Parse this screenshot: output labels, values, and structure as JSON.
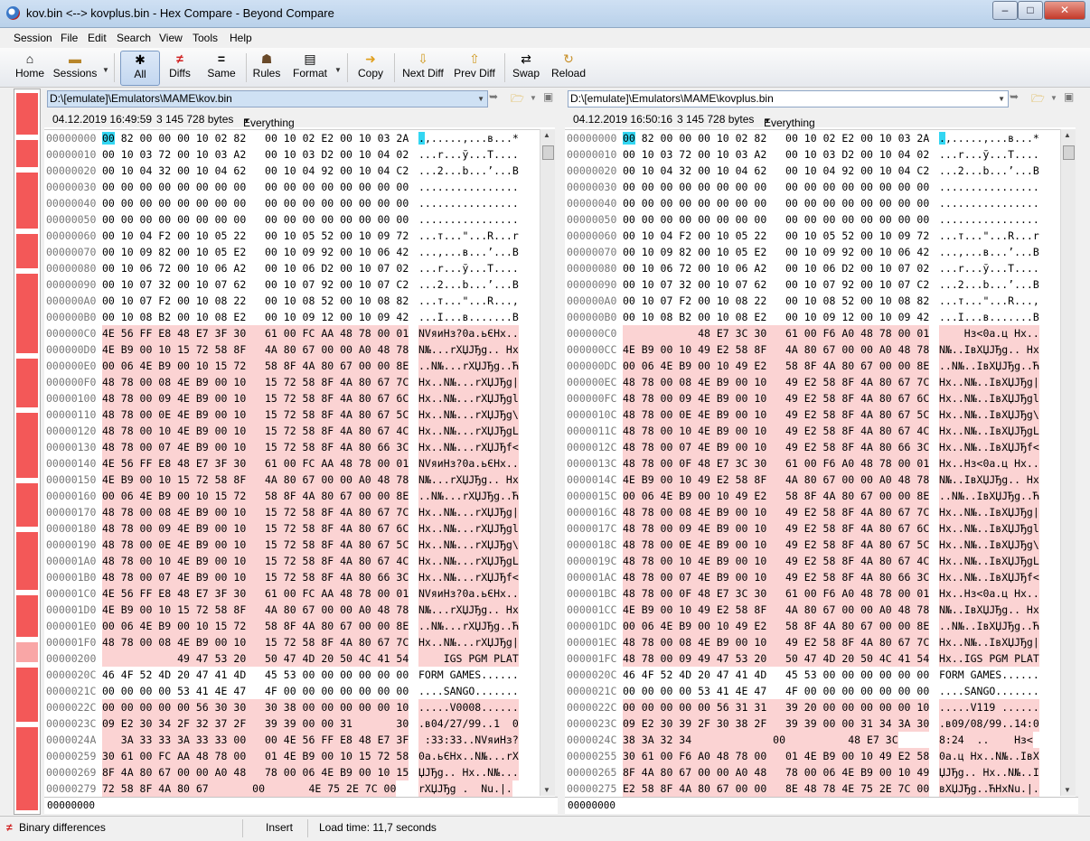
{
  "window": {
    "title": "kov.bin <--> kovplus.bin - Hex Compare - Beyond Compare"
  },
  "menu": [
    "Session",
    "File",
    "Edit",
    "Search",
    "View",
    "Tools",
    "Help"
  ],
  "toolbar": {
    "home": "Home",
    "sessions": "Sessions",
    "all": "All",
    "diffs": "Diffs",
    "same": "Same",
    "rules": "Rules",
    "format": "Format",
    "copy": "Copy",
    "next_diff": "Next Diff",
    "prev_diff": "Prev Diff",
    "swap": "Swap",
    "reload": "Reload"
  },
  "left": {
    "path": "D:\\[emulate]\\Emulators\\MAME\\kov.bin",
    "date": "04.12.2019 16:49:59",
    "size": "3 145 728 bytes",
    "format": "Everything Else",
    "offset": "00000000",
    "rows": [
      {
        "a": "00000000",
        "h": "00 82 00 00 00 10 02 82   00 10 02 E2 00 10 03 2A",
        "t": ".,.....,...в...*",
        "d": 0
      },
      {
        "a": "00000010",
        "h": "00 10 03 72 00 10 03 A2   00 10 03 D2 00 10 04 02",
        "t": "...r...ў...T....",
        "d": 0
      },
      {
        "a": "00000020",
        "h": "00 10 04 32 00 10 04 62   00 10 04 92 00 10 04 C2",
        "t": "...2...b...’...В",
        "d": 0
      },
      {
        "a": "00000030",
        "h": "00 00 00 00 00 00 00 00   00 00 00 00 00 00 00 00",
        "t": "................",
        "d": 0
      },
      {
        "a": "00000040",
        "h": "00 00 00 00 00 00 00 00   00 00 00 00 00 00 00 00",
        "t": "................",
        "d": 0
      },
      {
        "a": "00000050",
        "h": "00 00 00 00 00 00 00 00   00 00 00 00 00 00 00 00",
        "t": "................",
        "d": 0
      },
      {
        "a": "00000060",
        "h": "00 10 04 F2 00 10 05 22   00 10 05 52 00 10 09 72",
        "t": "...т...\"...R...r",
        "d": 0
      },
      {
        "a": "00000070",
        "h": "00 10 09 82 00 10 05 E2   00 10 09 92 00 10 06 42",
        "t": "...,...в...’...B",
        "d": 0
      },
      {
        "a": "00000080",
        "h": "00 10 06 72 00 10 06 A2   00 10 06 D2 00 10 07 02",
        "t": "...r...ў...T....",
        "d": 0
      },
      {
        "a": "00000090",
        "h": "00 10 07 32 00 10 07 62   00 10 07 92 00 10 07 C2",
        "t": "...2...b...’...В",
        "d": 0
      },
      {
        "a": "000000A0",
        "h": "00 10 07 F2 00 10 08 22   00 10 08 52 00 10 08 82",
        "t": "...т...\"...R...,",
        "d": 0
      },
      {
        "a": "000000B0",
        "h": "00 10 08 B2 00 10 08 E2   00 10 09 12 00 10 09 42",
        "t": "...I...в.......B",
        "d": 0
      },
      {
        "a": "000000C0",
        "h": "4E 56 FF E8 48 E7 3F 30   61 00 FC AA 48 78 00 01",
        "t": "NVяиНз?0a.ьЄHx..",
        "d": 1
      },
      {
        "a": "000000D0",
        "h": "4E B9 00 10 15 72 58 8F   4A 80 67 00 00 A0 48 78",
        "t": "N№...rXЏJЂg.. Hx",
        "d": 1
      },
      {
        "a": "000000E0",
        "h": "00 06 4E B9 00 10 15 72   58 8F 4A 80 67 00 00 8E",
        "t": "..N№...rXЏJЂg..Ћ",
        "d": 1
      },
      {
        "a": "000000F0",
        "h": "48 78 00 08 4E B9 00 10   15 72 58 8F 4A 80 67 7C",
        "t": "Hx..N№...rXЏJЂg|",
        "d": 1
      },
      {
        "a": "00000100",
        "h": "48 78 00 09 4E B9 00 10   15 72 58 8F 4A 80 67 6C",
        "t": "Hx..N№...rXЏJЂgl",
        "d": 1
      },
      {
        "a": "00000110",
        "h": "48 78 00 0E 4E B9 00 10   15 72 58 8F 4A 80 67 5C",
        "t": "Hx..N№...rXЏJЂg\\",
        "d": 1
      },
      {
        "a": "00000120",
        "h": "48 78 00 10 4E B9 00 10   15 72 58 8F 4A 80 67 4C",
        "t": "Hx..N№...rXЏJЂgL",
        "d": 1
      },
      {
        "a": "00000130",
        "h": "48 78 00 07 4E B9 00 10   15 72 58 8F 4A 80 66 3C",
        "t": "Hx..N№...rXЏJЂf<",
        "d": 1
      },
      {
        "a": "00000140",
        "h": "4E 56 FF E8 48 E7 3F 30   61 00 FC AA 48 78 00 01",
        "t": "NVяиНз?0a.ьЄHx..",
        "d": 1
      },
      {
        "a": "00000150",
        "h": "4E B9 00 10 15 72 58 8F   4A 80 67 00 00 A0 48 78",
        "t": "N№...rXЏJЂg.. Hx",
        "d": 1
      },
      {
        "a": "00000160",
        "h": "00 06 4E B9 00 10 15 72   58 8F 4A 80 67 00 00 8E",
        "t": "..N№...rXЏJЂg..Ћ",
        "d": 1
      },
      {
        "a": "00000170",
        "h": "48 78 00 08 4E B9 00 10   15 72 58 8F 4A 80 67 7C",
        "t": "Hx..N№...rXЏJЂg|",
        "d": 1
      },
      {
        "a": "00000180",
        "h": "48 78 00 09 4E B9 00 10   15 72 58 8F 4A 80 67 6C",
        "t": "Hx..N№...rXЏJЂgl",
        "d": 1
      },
      {
        "a": "00000190",
        "h": "48 78 00 0E 4E B9 00 10   15 72 58 8F 4A 80 67 5C",
        "t": "Hx..N№...rXЏJЂg\\",
        "d": 1
      },
      {
        "a": "000001A0",
        "h": "48 78 00 10 4E B9 00 10   15 72 58 8F 4A 80 67 4C",
        "t": "Hx..N№...rXЏJЂgL",
        "d": 1
      },
      {
        "a": "000001B0",
        "h": "48 78 00 07 4E B9 00 10   15 72 58 8F 4A 80 66 3C",
        "t": "Hx..N№...rXЏJЂf<",
        "d": 1
      },
      {
        "a": "000001C0",
        "h": "4E 56 FF E8 48 E7 3F 30   61 00 FC AA 48 78 00 01",
        "t": "NVяиНз?0a.ьЄHx..",
        "d": 1
      },
      {
        "a": "000001D0",
        "h": "4E B9 00 10 15 72 58 8F   4A 80 67 00 00 A0 48 78",
        "t": "N№...rXЏJЂg.. Hx",
        "d": 1
      },
      {
        "a": "000001E0",
        "h": "00 06 4E B9 00 10 15 72   58 8F 4A 80 67 00 00 8E",
        "t": "..N№...rXЏJЂg..Ћ",
        "d": 1
      },
      {
        "a": "000001F0",
        "h": "48 78 00 08 4E B9 00 10   15 72 58 8F 4A 80 67 7C",
        "t": "Hx..N№...rXЏJЂg|",
        "d": 1
      },
      {
        "a": "00000200",
        "h": "            49 47 53 20   50 47 4D 20 50 4C 41 54",
        "t": "    IGS PGM PLAT",
        "d": 1
      },
      {
        "a": "0000020C",
        "h": "46 4F 52 4D 20 47 41 4D   45 53 00 00 00 00 00 00",
        "t": "FORM GAMES......",
        "d": 0
      },
      {
        "a": "0000021C",
        "h": "00 00 00 00 53 41 4E 47   4F 00 00 00 00 00 00 00",
        "t": "....SANGO.......",
        "d": 0
      },
      {
        "a": "0000022C",
        "h": "00 00 00 00 00 56 30 30   30 38 00 00 00 00 00 10",
        "t": ".....V0008......",
        "d": 1
      },
      {
        "a": "0000023C",
        "h": "09 E2 30 34 2F 32 37 2F   39 39 00 00 31       30",
        "t": ".в04/27/99..1  0",
        "d": 1
      },
      {
        "a": "0000024A",
        "h": "   3A 33 33 3A 33 33 00   00 4E 56 FF E8 48 E7 3F",
        "t": " :33:33..NVяиНз?",
        "d": 1
      },
      {
        "a": "00000259",
        "h": "30 61 00 FC AA 48 78 00   01 4E B9 00 10 15 72 58",
        "t": "0a.ьЄHx..N№...rX",
        "d": 1
      },
      {
        "a": "00000269",
        "h": "8F 4A 80 67 00 00 A0 48   78 00 06 4E B9 00 10 15",
        "t": "ЏJЂg.. Hx..N№...",
        "d": 1
      },
      {
        "a": "00000279",
        "h": "72 58 8F 4A 80 67       00       4E 75 2E 7C 00",
        "t": "rXЏJЂg .  Nu.|.",
        "d": 1
      }
    ]
  },
  "right": {
    "path": "D:\\[emulate]\\Emulators\\MAME\\kovplus.bin",
    "date": "04.12.2019 16:50:16",
    "size": "3 145 728 bytes",
    "format": "Everything Else",
    "offset": "00000000",
    "rows": [
      {
        "a": "00000000",
        "h": "00 82 00 00 00 10 02 82   00 10 02 E2 00 10 03 2A",
        "t": ".,.....,...в...*",
        "d": 0
      },
      {
        "a": "00000010",
        "h": "00 10 03 72 00 10 03 A2   00 10 03 D2 00 10 04 02",
        "t": "...r...ў...T....",
        "d": 0
      },
      {
        "a": "00000020",
        "h": "00 10 04 32 00 10 04 62   00 10 04 92 00 10 04 C2",
        "t": "...2...b...’...В",
        "d": 0
      },
      {
        "a": "00000030",
        "h": "00 00 00 00 00 00 00 00   00 00 00 00 00 00 00 00",
        "t": "................",
        "d": 0
      },
      {
        "a": "00000040",
        "h": "00 00 00 00 00 00 00 00   00 00 00 00 00 00 00 00",
        "t": "................",
        "d": 0
      },
      {
        "a": "00000050",
        "h": "00 00 00 00 00 00 00 00   00 00 00 00 00 00 00 00",
        "t": "................",
        "d": 0
      },
      {
        "a": "00000060",
        "h": "00 10 04 F2 00 10 05 22   00 10 05 52 00 10 09 72",
        "t": "...т...\"...R...r",
        "d": 0
      },
      {
        "a": "00000070",
        "h": "00 10 09 82 00 10 05 E2   00 10 09 92 00 10 06 42",
        "t": "...,...в...’...B",
        "d": 0
      },
      {
        "a": "00000080",
        "h": "00 10 06 72 00 10 06 A2   00 10 06 D2 00 10 07 02",
        "t": "...r...ў...T....",
        "d": 0
      },
      {
        "a": "00000090",
        "h": "00 10 07 32 00 10 07 62   00 10 07 92 00 10 07 C2",
        "t": "...2...b...’...В",
        "d": 0
      },
      {
        "a": "000000A0",
        "h": "00 10 07 F2 00 10 08 22   00 10 08 52 00 10 08 82",
        "t": "...т...\"...R...,",
        "d": 0
      },
      {
        "a": "000000B0",
        "h": "00 10 08 B2 00 10 08 E2   00 10 09 12 00 10 09 42",
        "t": "...I...в.......B",
        "d": 0
      },
      {
        "a": "000000C0",
        "h": "            48 E7 3C 30   61 00 F6 A0 48 78 00 01",
        "t": "    Нз<0a.ц Hx..",
        "d": 1
      },
      {
        "a": "000000CC",
        "h": "4E B9 00 10 49 E2 58 8F   4A 80 67 00 00 A0 48 78",
        "t": "N№..IвXЏJЂg.. Hx",
        "d": 1
      },
      {
        "a": "000000DC",
        "h": "00 06 4E B9 00 10 49 E2   58 8F 4A 80 67 00 00 8E",
        "t": "..N№..IвXЏJЂg..Ћ",
        "d": 1
      },
      {
        "a": "000000EC",
        "h": "48 78 00 08 4E B9 00 10   49 E2 58 8F 4A 80 67 7C",
        "t": "Hx..N№..IвXЏJЂg|",
        "d": 1
      },
      {
        "a": "000000FC",
        "h": "48 78 00 09 4E B9 00 10   49 E2 58 8F 4A 80 67 6C",
        "t": "Hx..N№..IвXЏJЂgl",
        "d": 1
      },
      {
        "a": "0000010C",
        "h": "48 78 00 0E 4E B9 00 10   49 E2 58 8F 4A 80 67 5C",
        "t": "Hx..N№..IвXЏJЂg\\",
        "d": 1
      },
      {
        "a": "0000011C",
        "h": "48 78 00 10 4E B9 00 10   49 E2 58 8F 4A 80 67 4C",
        "t": "Hx..N№..IвXЏJЂgL",
        "d": 1
      },
      {
        "a": "0000012C",
        "h": "48 78 00 07 4E B9 00 10   49 E2 58 8F 4A 80 66 3C",
        "t": "Hx..N№..IвXЏJЂf<",
        "d": 1
      },
      {
        "a": "0000013C",
        "h": "48 78 00 0F 48 E7 3C 30   61 00 F6 A0 48 78 00 01",
        "t": "Hx..Нз<0a.ц Hx..",
        "d": 1
      },
      {
        "a": "0000014C",
        "h": "4E B9 00 10 49 E2 58 8F   4A 80 67 00 00 A0 48 78",
        "t": "N№..IвXЏJЂg.. Hx",
        "d": 1
      },
      {
        "a": "0000015C",
        "h": "00 06 4E B9 00 10 49 E2   58 8F 4A 80 67 00 00 8E",
        "t": "..N№..IвXЏJЂg..Ћ",
        "d": 1
      },
      {
        "a": "0000016C",
        "h": "48 78 00 08 4E B9 00 10   49 E2 58 8F 4A 80 67 7C",
        "t": "Hx..N№..IвXЏJЂg|",
        "d": 1
      },
      {
        "a": "0000017C",
        "h": "48 78 00 09 4E B9 00 10   49 E2 58 8F 4A 80 67 6C",
        "t": "Hx..N№..IвXЏJЂgl",
        "d": 1
      },
      {
        "a": "0000018C",
        "h": "48 78 00 0E 4E B9 00 10   49 E2 58 8F 4A 80 67 5C",
        "t": "Hx..N№..IвXЏJЂg\\",
        "d": 1
      },
      {
        "a": "0000019C",
        "h": "48 78 00 10 4E B9 00 10   49 E2 58 8F 4A 80 67 4C",
        "t": "Hx..N№..IвXЏJЂgL",
        "d": 1
      },
      {
        "a": "000001AC",
        "h": "48 78 00 07 4E B9 00 10   49 E2 58 8F 4A 80 66 3C",
        "t": "Hx..N№..IвXЏJЂf<",
        "d": 1
      },
      {
        "a": "000001BC",
        "h": "48 78 00 0F 48 E7 3C 30   61 00 F6 A0 48 78 00 01",
        "t": "Hx..Нз<0a.ц Hx..",
        "d": 1
      },
      {
        "a": "000001CC",
        "h": "4E B9 00 10 49 E2 58 8F   4A 80 67 00 00 A0 48 78",
        "t": "N№..IвXЏJЂg.. Hx",
        "d": 1
      },
      {
        "a": "000001DC",
        "h": "00 06 4E B9 00 10 49 E2   58 8F 4A 80 67 00 00 8E",
        "t": "..N№..IвXЏJЂg..Ћ",
        "d": 1
      },
      {
        "a": "000001EC",
        "h": "48 78 00 08 4E B9 00 10   49 E2 58 8F 4A 80 67 7C",
        "t": "Hx..N№..IвXЏJЂg|",
        "d": 1
      },
      {
        "a": "000001FC",
        "h": "48 78 00 09 49 47 53 20   50 47 4D 20 50 4C 41 54",
        "t": "Hx..IGS PGM PLAT",
        "d": 1
      },
      {
        "a": "0000020C",
        "h": "46 4F 52 4D 20 47 41 4D   45 53 00 00 00 00 00 00",
        "t": "FORM GAMES......",
        "d": 0
      },
      {
        "a": "0000021C",
        "h": "00 00 00 00 53 41 4E 47   4F 00 00 00 00 00 00 00",
        "t": "....SANGO.......",
        "d": 0
      },
      {
        "a": "0000022C",
        "h": "00 00 00 00 00 56 31 31   39 20 00 00 00 00 00 10",
        "t": ".....V119 ......",
        "d": 1
      },
      {
        "a": "0000023C",
        "h": "09 E2 30 39 2F 30 38 2F   39 39 00 00 31 34 3A 30",
        "t": ".в09/08/99..14:0",
        "d": 1
      },
      {
        "a": "0000024C",
        "h": "38 3A 32 34             00          48 E7 3C",
        "t": "8:24  ..    Нз<",
        "d": 1
      },
      {
        "a": "00000255",
        "h": "30 61 00 F6 A0 48 78 00   01 4E B9 00 10 49 E2 58",
        "t": "0a.ц Hx..N№..IвX",
        "d": 1
      },
      {
        "a": "00000265",
        "h": "8F 4A 80 67 00 00 A0 48   78 00 06 4E B9 00 10 49",
        "t": "ЏJЂg.. Hx..N№..I",
        "d": 1
      },
      {
        "a": "00000275",
        "h": "E2 58 8F 4A 80 67 00 00   8E 48 78 4E 75 2E 7C 00",
        "t": "вXЏJЂg..ЋHxNu.|.",
        "d": 1
      }
    ]
  },
  "status": {
    "mode": "Binary differences",
    "insert": "Insert",
    "load_time": "Load time: 11,7 seconds"
  },
  "colors": {
    "diff_bg": "#fbd3d3",
    "diff_text": "#d02020",
    "cursor": "#33d6f2",
    "overview_mark": "#f35858"
  },
  "icons": [
    "home-icon",
    "sessions-icon",
    "asterisk-icon",
    "not-equal-icon",
    "equal-icon",
    "rules-icon",
    "format-icon",
    "copy-icon",
    "next-diff-icon",
    "prev-diff-icon",
    "swap-icon",
    "reload-icon"
  ]
}
